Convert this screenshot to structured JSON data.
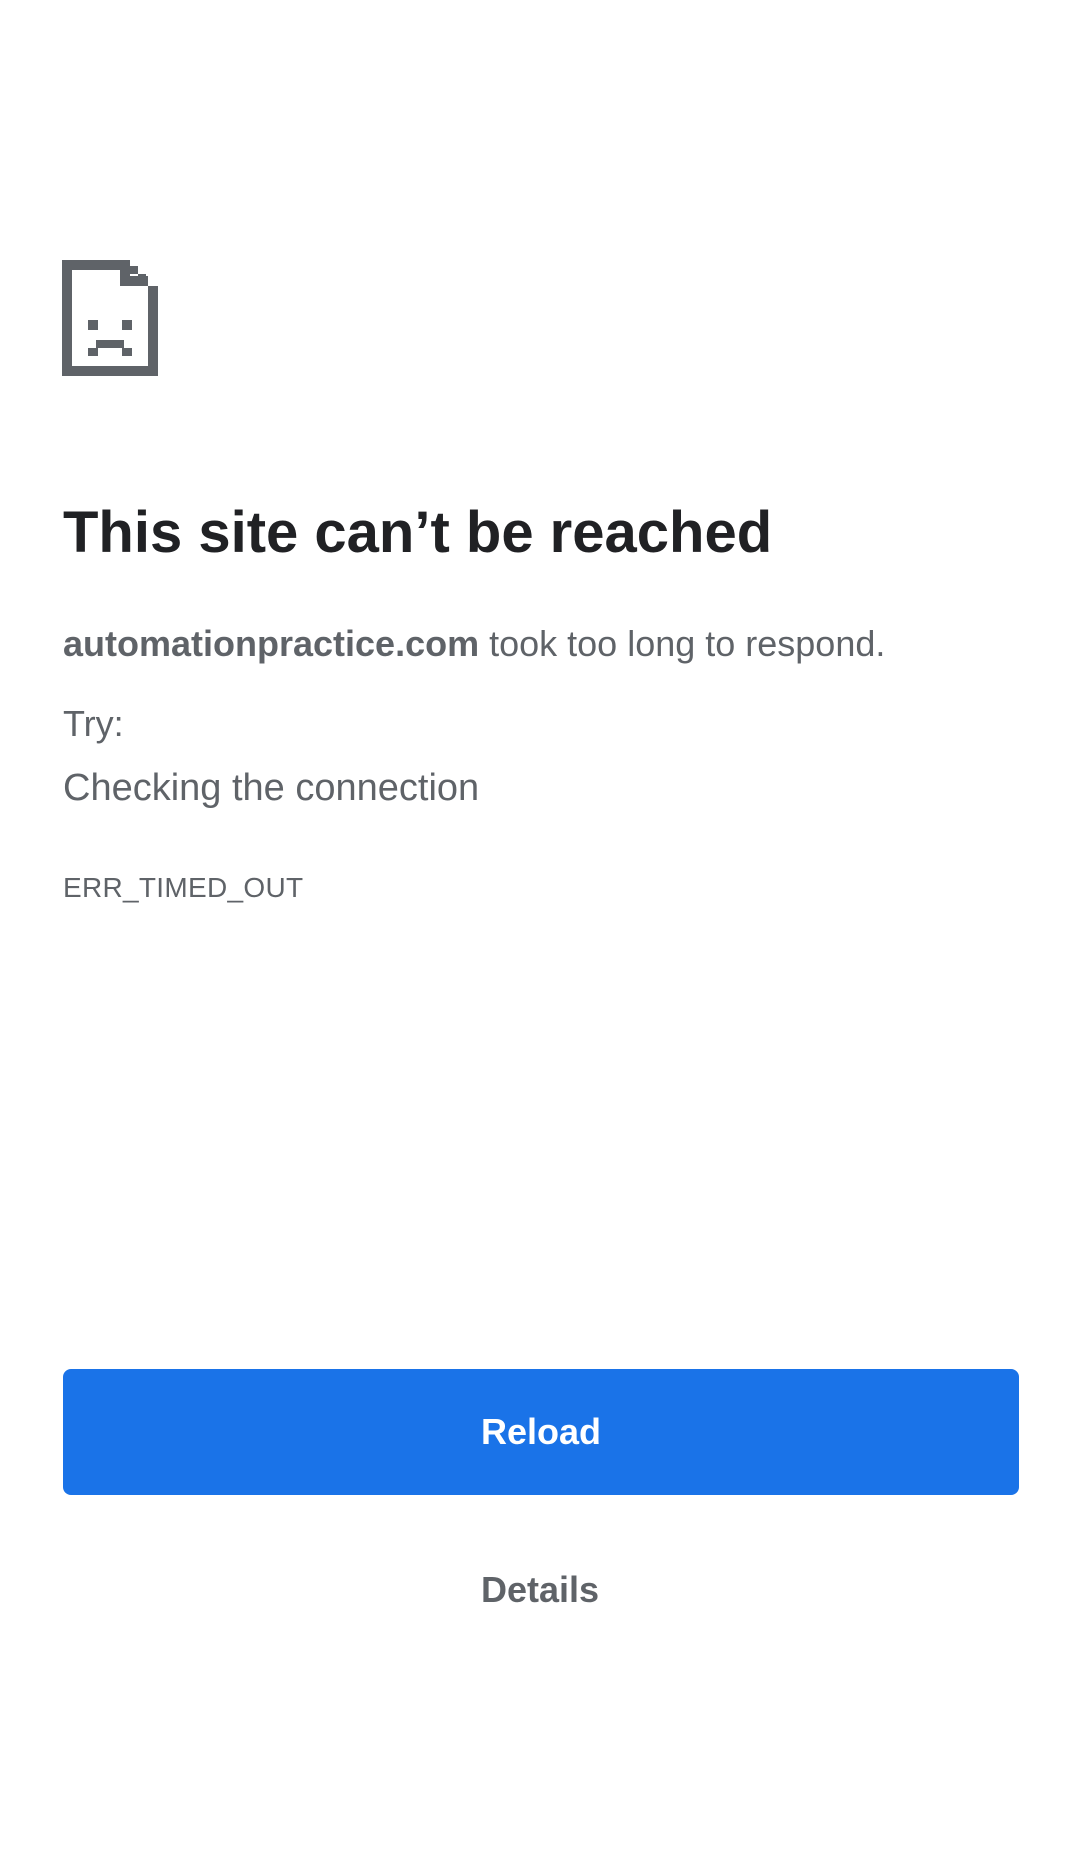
{
  "error": {
    "icon": "sad-document-icon",
    "title": "This site can’t be reached",
    "host": "automationpractice.com",
    "message": " took too long to respond.",
    "try_label": "Try:",
    "suggestion": "Checking the connection",
    "code": "ERR_TIMED_OUT"
  },
  "actions": {
    "reload_label": "Reload",
    "details_label": "Details"
  },
  "colors": {
    "accent": "#1a73e8",
    "heading": "#202124",
    "body_text": "#5f6368",
    "icon": "#5f6368"
  }
}
